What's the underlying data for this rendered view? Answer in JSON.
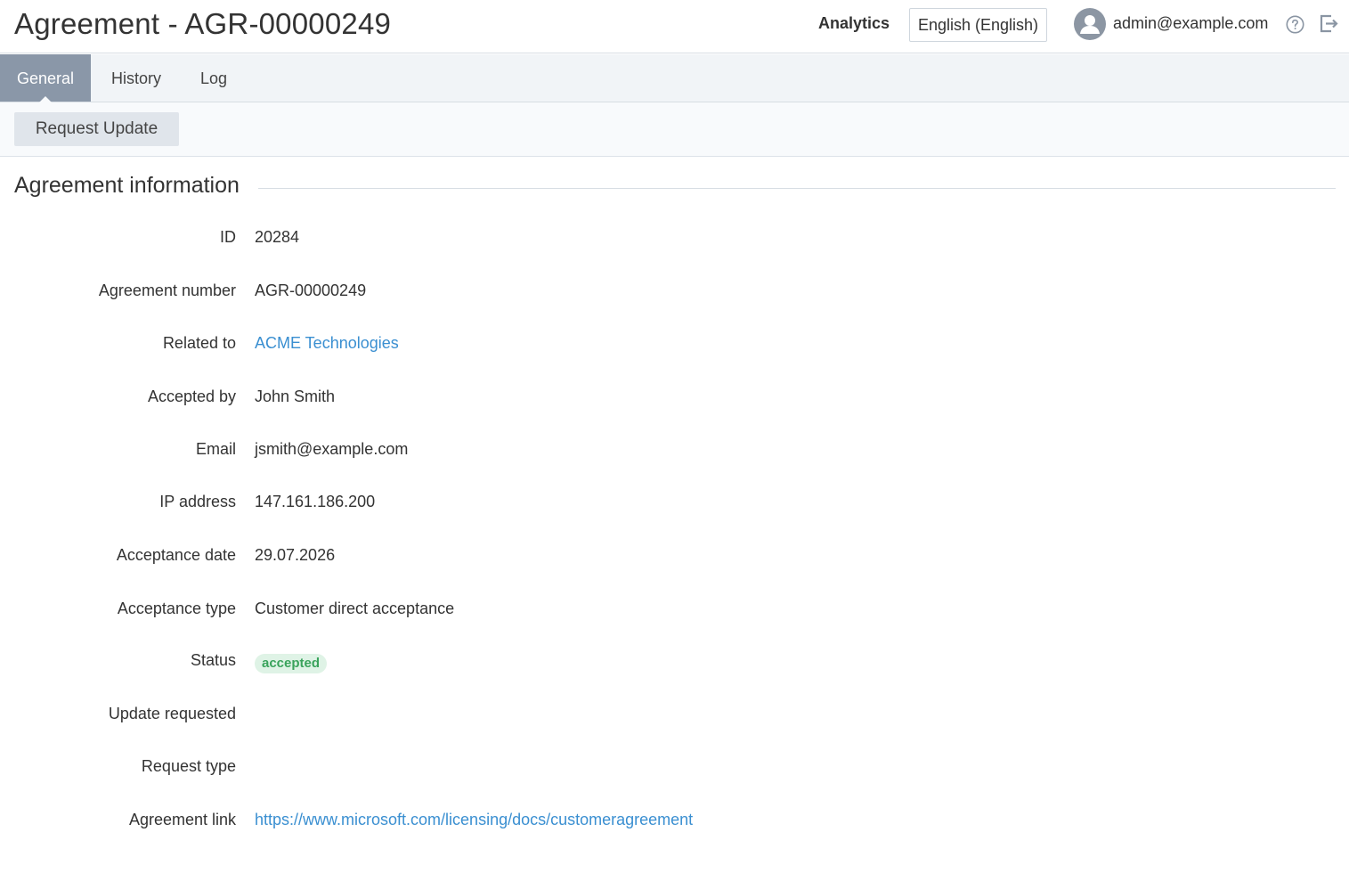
{
  "header": {
    "title": "Agreement - AGR-00000249",
    "analytics_label": "Analytics",
    "language": "English (English)",
    "user_email": "admin@example.com"
  },
  "tabs": [
    {
      "label": "General",
      "active": true
    },
    {
      "label": "History",
      "active": false
    },
    {
      "label": "Log",
      "active": false
    }
  ],
  "toolbar": {
    "request_update_label": "Request Update"
  },
  "section": {
    "title": "Agreement information",
    "fields": {
      "id": {
        "label": "ID",
        "value": "20284"
      },
      "agreement_number": {
        "label": "Agreement number",
        "value": "AGR-00000249"
      },
      "related_to": {
        "label": "Related to",
        "value": "ACME Technologies"
      },
      "accepted_by": {
        "label": "Accepted by",
        "value": "John Smith"
      },
      "email": {
        "label": "Email",
        "value": "jsmith@example.com"
      },
      "ip_address": {
        "label": "IP address",
        "value": "147.161.186.200"
      },
      "acceptance_date": {
        "label": "Acceptance date",
        "value": "29.07.2026"
      },
      "acceptance_type": {
        "label": "Acceptance type",
        "value": "Customer direct acceptance"
      },
      "status": {
        "label": "Status",
        "value": "accepted"
      },
      "update_requested": {
        "label": "Update requested",
        "value": ""
      },
      "request_type": {
        "label": "Request type",
        "value": ""
      },
      "agreement_link": {
        "label": "Agreement link",
        "value": "https://www.microsoft.com/licensing/docs/customeragreement"
      }
    }
  },
  "colors": {
    "accent_link": "#3a8fd1",
    "active_tab": "#8a97a8",
    "status_accepted_bg": "#dff3e6",
    "status_accepted_text": "#3aa35c"
  },
  "icons": {
    "avatar": "user-avatar-icon",
    "help": "help-circle-icon",
    "logout": "logout-icon"
  }
}
